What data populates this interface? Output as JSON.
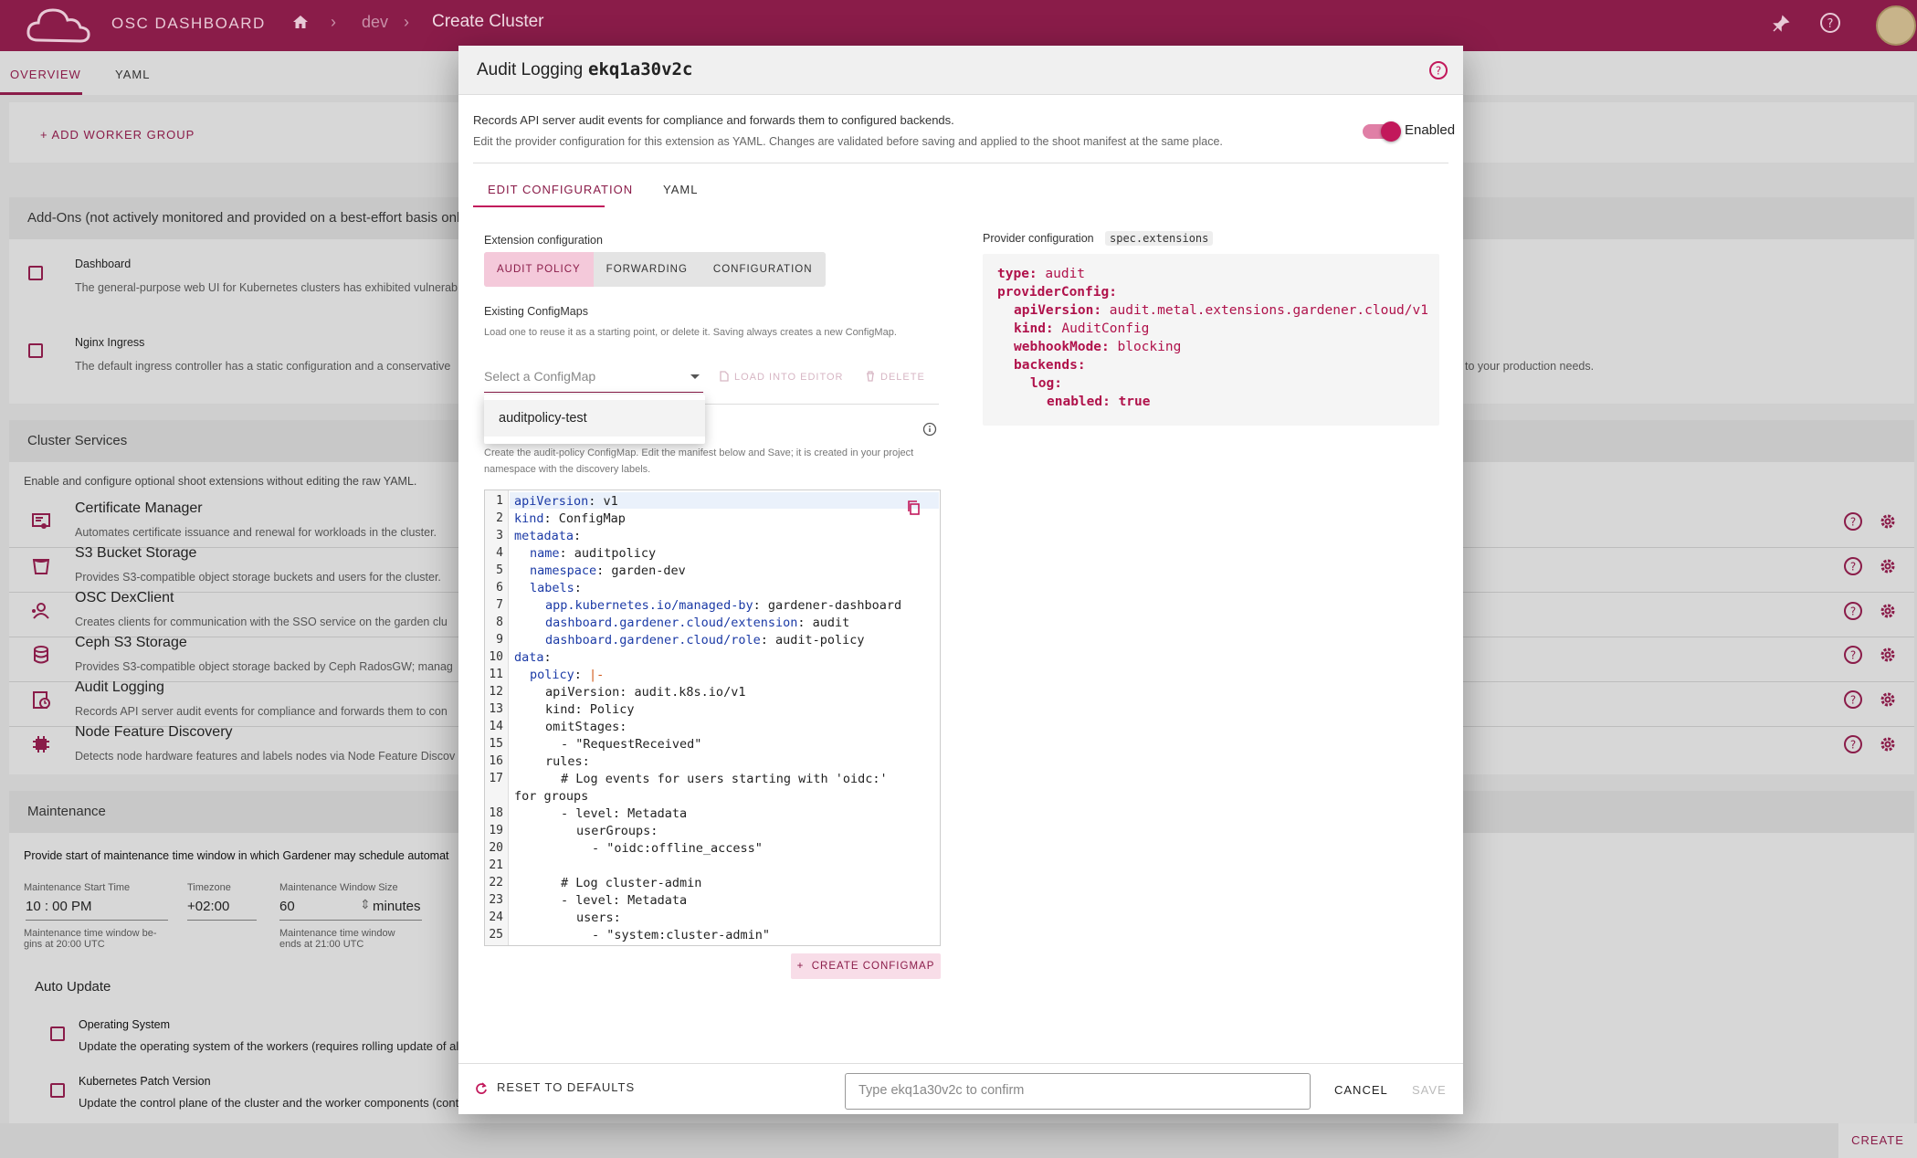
{
  "topbar": {
    "app_title": "OSC DASHBOARD",
    "breadcrumb": [
      "dev",
      "Create Cluster"
    ],
    "icons": [
      "cloud-logo-icon",
      "home-icon",
      "pin-icon",
      "help-icon",
      "avatar"
    ]
  },
  "page_tabs": [
    "OVERVIEW",
    "YAML"
  ],
  "workers": {
    "add_label": "ADD WORKER GROUP"
  },
  "addons": {
    "title": "Add-Ons (not actively monitored and provided on a best-effort basis only)",
    "items": [
      {
        "name": "Dashboard",
        "desc": "The general-purpose web UI for Kubernetes clusters has exhibited vulnerab"
      },
      {
        "name": "Nginx Ingress",
        "desc": "The default ingress controller has a static configuration and a conservative"
      }
    ],
    "right_fragment": "to your production needs."
  },
  "services": {
    "title": "Cluster Services",
    "subtitle": "Enable and configure optional shoot extensions without editing the raw YAML.",
    "items": [
      {
        "name": "Certificate Manager",
        "desc": "Automates certificate issuance and renewal for workloads in the cluster.",
        "icon": "certificate-icon"
      },
      {
        "name": "S3 Bucket Storage",
        "desc": "Provides S3-compatible object storage buckets and users for the cluster.",
        "icon": "bucket-icon"
      },
      {
        "name": "OSC DexClient",
        "desc": "Creates clients for communication with the SSO service on the garden clu",
        "icon": "user-network-icon"
      },
      {
        "name": "Ceph S3 Storage",
        "desc": "Provides S3-compatible object storage backed by Ceph RadosGW; manag",
        "icon": "database-icon"
      },
      {
        "name": "Audit Logging",
        "desc": "Records API server audit events for compliance and forwards them to con",
        "icon": "audit-clock-icon"
      },
      {
        "name": "Node Feature Discovery",
        "desc": "Detects node hardware features and labels nodes via Node Feature Discov",
        "icon": "chip-icon"
      }
    ]
  },
  "maintenance": {
    "title": "Maintenance",
    "intro": "Provide start of maintenance time window in which Gardener may schedule automat",
    "start_label": "Maintenance Start Time",
    "start_value": "10 : 00   PM",
    "start_hint_1": "Maintenance time window be-",
    "start_hint_2": "gins at 20:00 UTC",
    "tz_label": "Timezone",
    "tz_value": "+02:00",
    "size_label": "Maintenance Window Size",
    "size_value": "60",
    "size_unit": "minutes",
    "size_hint_1": "Maintenance time window",
    "size_hint_2": "ends at 21:00 UTC",
    "auto_update": "Auto Update",
    "os_label": "Operating System",
    "os_desc": "Update the operating system of the workers (requires rolling update of al",
    "k8s_label": "Kubernetes Patch Version",
    "k8s_desc": "Update the control plane of the cluster and the worker components (cont"
  },
  "footer": {
    "create": "CREATE"
  },
  "dialog": {
    "title": "Audit Logging",
    "name": "ekq1a30v2c",
    "description": "Records API server audit events for compliance and forwards them to configured backends.",
    "subdescription": "Edit the provider configuration for this extension as YAML. Changes are validated before saving and applied to the shoot manifest at the same place.",
    "enabled_label": "Enabled",
    "enabled": true,
    "tabs": [
      "EDIT CONFIGURATION",
      "YAML"
    ],
    "ext_config_label": "Extension configuration",
    "segments": [
      "AUDIT POLICY",
      "FORWARDING",
      "CONFIGURATION"
    ],
    "existing_label": "Existing ConfigMaps",
    "existing_hint": "Load one to reuse it as a starting point, or delete it. Saving always creates a new ConfigMap.",
    "select_placeholder": "Select a ConfigMap",
    "load_label": "LOAD INTO EDITOR",
    "delete_label": "DELETE",
    "menu_items": [
      "auditpolicy-test"
    ],
    "create_hint_1": "Create the audit-policy ConfigMap. Edit the manifest below and Save; it is created in your project",
    "create_hint_2": "namespace with the discovery labels.",
    "code_lines": [
      {
        "n": "1",
        "k": "apiVersion",
        "v": " v1",
        "i": 0
      },
      {
        "n": "2",
        "k": "kind",
        "v": " ConfigMap",
        "i": 0
      },
      {
        "n": "3",
        "k": "metadata",
        "v": "",
        "i": 0
      },
      {
        "n": "4",
        "k": "name",
        "v": " auditpolicy",
        "i": 1
      },
      {
        "n": "5",
        "k": "namespace",
        "v": " garden-dev",
        "i": 1
      },
      {
        "n": "6",
        "k": "labels",
        "v": "",
        "i": 1
      },
      {
        "n": "7",
        "k": "app.kubernetes.io/managed-by",
        "v": " gardener-dashboard",
        "i": 2
      },
      {
        "n": "8",
        "k": "dashboard.gardener.cloud/extension",
        "v": " audit",
        "i": 2
      },
      {
        "n": "9",
        "k": "dashboard.gardener.cloud/role",
        "v": " audit-policy",
        "i": 2
      },
      {
        "n": "10",
        "k": "data",
        "v": "",
        "i": 0
      },
      {
        "n": "11",
        "k": "policy",
        "v": " |-",
        "i": 1
      },
      {
        "n": "12",
        "t": "apiVersion: audit.k8s.io/v1",
        "i": 2
      },
      {
        "n": "13",
        "t": "kind: Policy",
        "i": 2
      },
      {
        "n": "14",
        "t": "omitStages:",
        "i": 2
      },
      {
        "n": "15",
        "t": "- \"RequestReceived\"",
        "i": 3
      },
      {
        "n": "16",
        "t": "rules:",
        "i": 2
      },
      {
        "n": "17",
        "t": "# Log events for users starting with 'oidc:'",
        "i": 3
      },
      {
        "n": "",
        "t": "for groups",
        "i": 0
      },
      {
        "n": "18",
        "t": "- level: Metadata",
        "i": 3
      },
      {
        "n": "19",
        "t": "userGroups:",
        "i": 4
      },
      {
        "n": "20",
        "t": "- \"oidc:offline_access\"",
        "i": 5
      },
      {
        "n": "21",
        "t": "",
        "i": 0
      },
      {
        "n": "22",
        "t": "# Log cluster-admin",
        "i": 3
      },
      {
        "n": "23",
        "t": "- level: Metadata",
        "i": 3
      },
      {
        "n": "24",
        "t": "users:",
        "i": 4
      },
      {
        "n": "25",
        "t": "- \"system:cluster-admin\"",
        "i": 5
      }
    ],
    "create_configmap": "CREATE CONFIGMAP",
    "provider_label": "Provider configuration",
    "provider_path": "spec.extensions",
    "provider_lines": [
      {
        "k": "type",
        "v": " audit",
        "i": 0
      },
      {
        "k": "providerConfig",
        "v": "",
        "i": 0
      },
      {
        "k": "apiVersion",
        "v": " audit.metal.extensions.gardener.cloud/v1",
        "i": 1
      },
      {
        "k": "kind",
        "v": " AuditConfig",
        "i": 1
      },
      {
        "k": "webhookMode",
        "v": " blocking",
        "i": 1
      },
      {
        "k": "backends",
        "v": "",
        "i": 1
      },
      {
        "k": "log",
        "v": "",
        "i": 2
      },
      {
        "k": "enabled",
        "v": " true",
        "i": 3
      }
    ],
    "reset_label": "RESET TO DEFAULTS",
    "confirm_placeholder": "Type ekq1a30v2c to confirm",
    "cancel_label": "CANCEL",
    "save_label": "SAVE"
  },
  "colors": {
    "brand": "#8a1c49",
    "accent": "#c2185b",
    "code_key": "#1b3aa6",
    "provider_key": "#b0124b"
  }
}
